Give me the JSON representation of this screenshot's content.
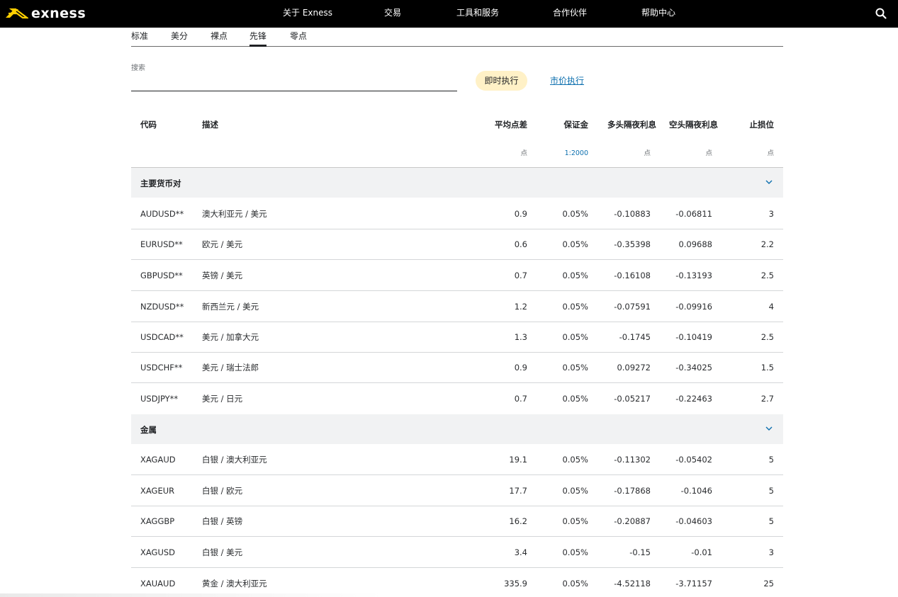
{
  "header": {
    "brand": "exness",
    "nav": [
      "关于 Exness",
      "交易",
      "工具和服务",
      "合作伙伴",
      "帮助中心"
    ],
    "search_icon": "search-icon",
    "logo_color": "#ffcf01"
  },
  "account_tabs": {
    "items": [
      "标准",
      "美分",
      "裸点",
      "先锋",
      "零点"
    ],
    "active": "先锋"
  },
  "search": {
    "label": "搜索",
    "value": ""
  },
  "execution": {
    "instant": "即时执行",
    "market": "市价执行",
    "selected": "即时执行"
  },
  "table": {
    "columns": {
      "symbol": "代码",
      "description": "描述",
      "spread": "平均点差",
      "margin": "保证金",
      "swap_long": "多头隔夜利息",
      "swap_short": "空头隔夜利息",
      "stop_level": "止损位"
    },
    "units": {
      "spread": "点",
      "margin": "1:2000",
      "swap_long": "点",
      "swap_short": "点",
      "stop_level": "点"
    },
    "groups": [
      {
        "title": "主要货币对",
        "expand_icon": "chevron-down-icon",
        "rows": [
          [
            "AUDUSD**",
            "澳大利亚元 / 美元",
            "0.9",
            "0.05%",
            "-0.10883",
            "-0.06811",
            "3"
          ],
          [
            "EURUSD**",
            "欧元 / 美元",
            "0.6",
            "0.05%",
            "-0.35398",
            "0.09688",
            "2.2"
          ],
          [
            "GBPUSD**",
            "英镑 / 美元",
            "0.7",
            "0.05%",
            "-0.16108",
            "-0.13193",
            "2.5"
          ],
          [
            "NZDUSD**",
            "新西兰元 / 美元",
            "1.2",
            "0.05%",
            "-0.07591",
            "-0.09916",
            "4"
          ],
          [
            "USDCAD**",
            "美元 / 加拿大元",
            "1.3",
            "0.05%",
            "-0.1745",
            "-0.10419",
            "2.5"
          ],
          [
            "USDCHF**",
            "美元 / 瑞士法郎",
            "0.9",
            "0.05%",
            "0.09272",
            "-0.34025",
            "1.5"
          ],
          [
            "USDJPY**",
            "美元 / 日元",
            "0.7",
            "0.05%",
            "-0.05217",
            "-0.22463",
            "2.7"
          ]
        ]
      },
      {
        "title": "金属",
        "expand_icon": "chevron-down-icon",
        "rows": [
          [
            "XAGAUD",
            "白银 / 澳大利亚元",
            "19.1",
            "0.05%",
            "-0.11302",
            "-0.05402",
            "5"
          ],
          [
            "XAGEUR",
            "白银 / 欧元",
            "17.7",
            "0.05%",
            "-0.17868",
            "-0.1046",
            "5"
          ],
          [
            "XAGGBP",
            "白银 / 英镑",
            "16.2",
            "0.05%",
            "-0.20887",
            "-0.04603",
            "5"
          ],
          [
            "XAGUSD",
            "白银 / 美元",
            "3.4",
            "0.05%",
            "-0.15",
            "-0.01",
            "3"
          ],
          [
            "XAUAUD",
            "黄金 / 澳大利亚元",
            "335.9",
            "0.05%",
            "-4.52118",
            "-3.71157",
            "25"
          ]
        ]
      }
    ]
  }
}
